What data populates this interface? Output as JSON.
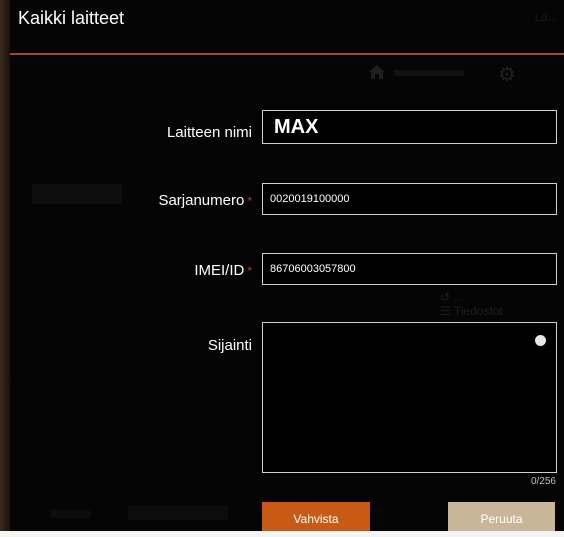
{
  "dialog": {
    "title": "Kaikki laitteet",
    "top_right_text": "Lo…",
    "fields": {
      "name": {
        "label": "Laitteen nimi",
        "value": "MAX"
      },
      "serial": {
        "label": "Sarjanumero",
        "required_mark": "*",
        "value": "0020019100000"
      },
      "imei": {
        "label": "IMEI/ID",
        "required_mark": "*",
        "value": "86706003057800"
      },
      "location": {
        "label": "Sijainti",
        "value": "",
        "counter": "0/256"
      }
    },
    "buttons": {
      "confirm": "Vahvista",
      "cancel": "Peruuta"
    }
  },
  "background": {
    "right_text_line1": "↺ …",
    "right_text_line2": "☰ Tiedostot"
  },
  "colors": {
    "accent": "#c95a16",
    "title_rule": "#a34d1a",
    "cancel": "#c7b697",
    "required": "#d0312d"
  },
  "icons": [
    "home-icon",
    "gear-icon",
    "info-icon"
  ]
}
